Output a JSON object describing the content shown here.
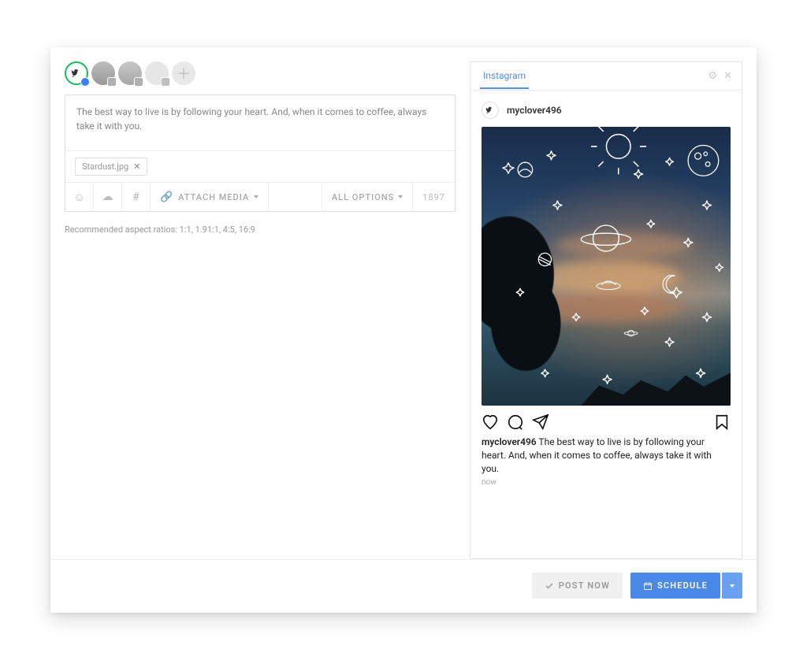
{
  "composer": {
    "text": "The best way to live is by following your heart. And, when it comes to coffee, always take it with you.",
    "attachment": "Stardust.jpg",
    "attach_media_label": "ATTACH MEDIA",
    "all_options_label": "ALL OPTIONS",
    "char_count": "1897",
    "aspect_hint": "Recommended aspect ratios: 1:1, 1.91:1, 4:5, 16:9"
  },
  "preview": {
    "tab_label": "Instagram",
    "username": "myclover496",
    "caption_user": "myclover496",
    "caption_text": "The best way to live is by following your heart. And, when it comes to coffee, always take it with you.",
    "timestamp": "now"
  },
  "footer": {
    "post_now_label": "POST NOW",
    "schedule_label": "SCHEDULE"
  }
}
